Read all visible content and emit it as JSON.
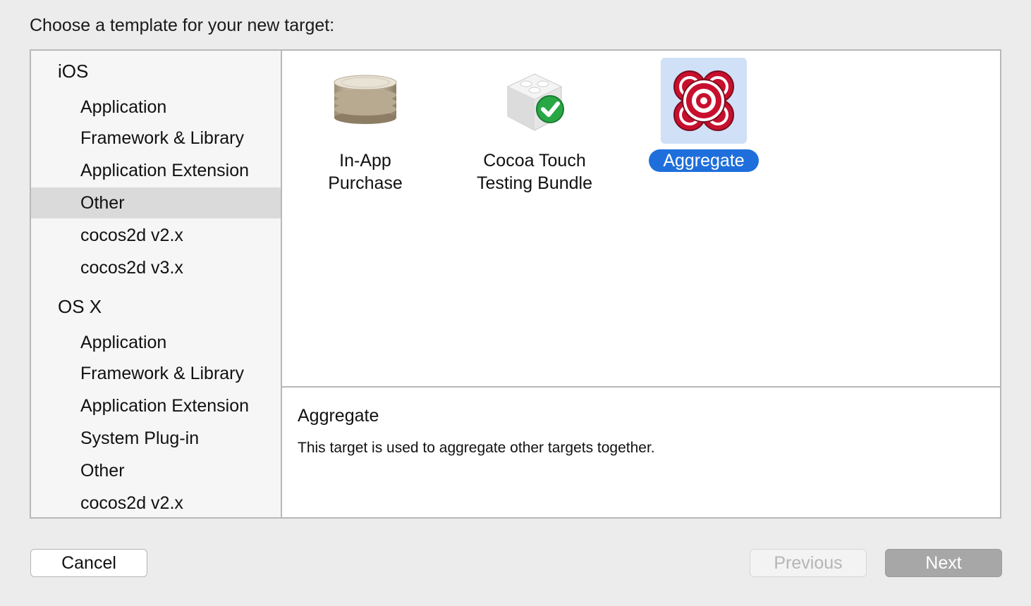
{
  "dialog": {
    "heading": "Choose a template for your new target:"
  },
  "sidebar": {
    "groups": [
      {
        "label": "iOS",
        "items": [
          "Application",
          "Framework & Library",
          "Application Extension",
          "Other",
          "cocos2d v2.x",
          "cocos2d v3.x"
        ]
      },
      {
        "label": "OS X",
        "items": [
          "Application",
          "Framework & Library",
          "Application Extension",
          "System Plug-in",
          "Other",
          "cocos2d v2.x"
        ]
      }
    ],
    "selected": "iOS / Other"
  },
  "templates": [
    {
      "label": "In-App\nPurchase",
      "icon": "coin-stack-icon",
      "selected": false
    },
    {
      "label": "Cocoa Touch\nTesting Bundle",
      "icon": "lego-check-icon",
      "selected": false
    },
    {
      "label": "Aggregate",
      "icon": "target-icon",
      "selected": true
    }
  ],
  "details": {
    "title": "Aggregate",
    "description": "This target is used to aggregate other targets together."
  },
  "buttons": {
    "cancel": "Cancel",
    "previous": "Previous",
    "next": "Next"
  },
  "colors": {
    "selection_blue": "#1e6fdc",
    "selection_light": "#cfe0f7",
    "target_red": "#c8102e"
  }
}
